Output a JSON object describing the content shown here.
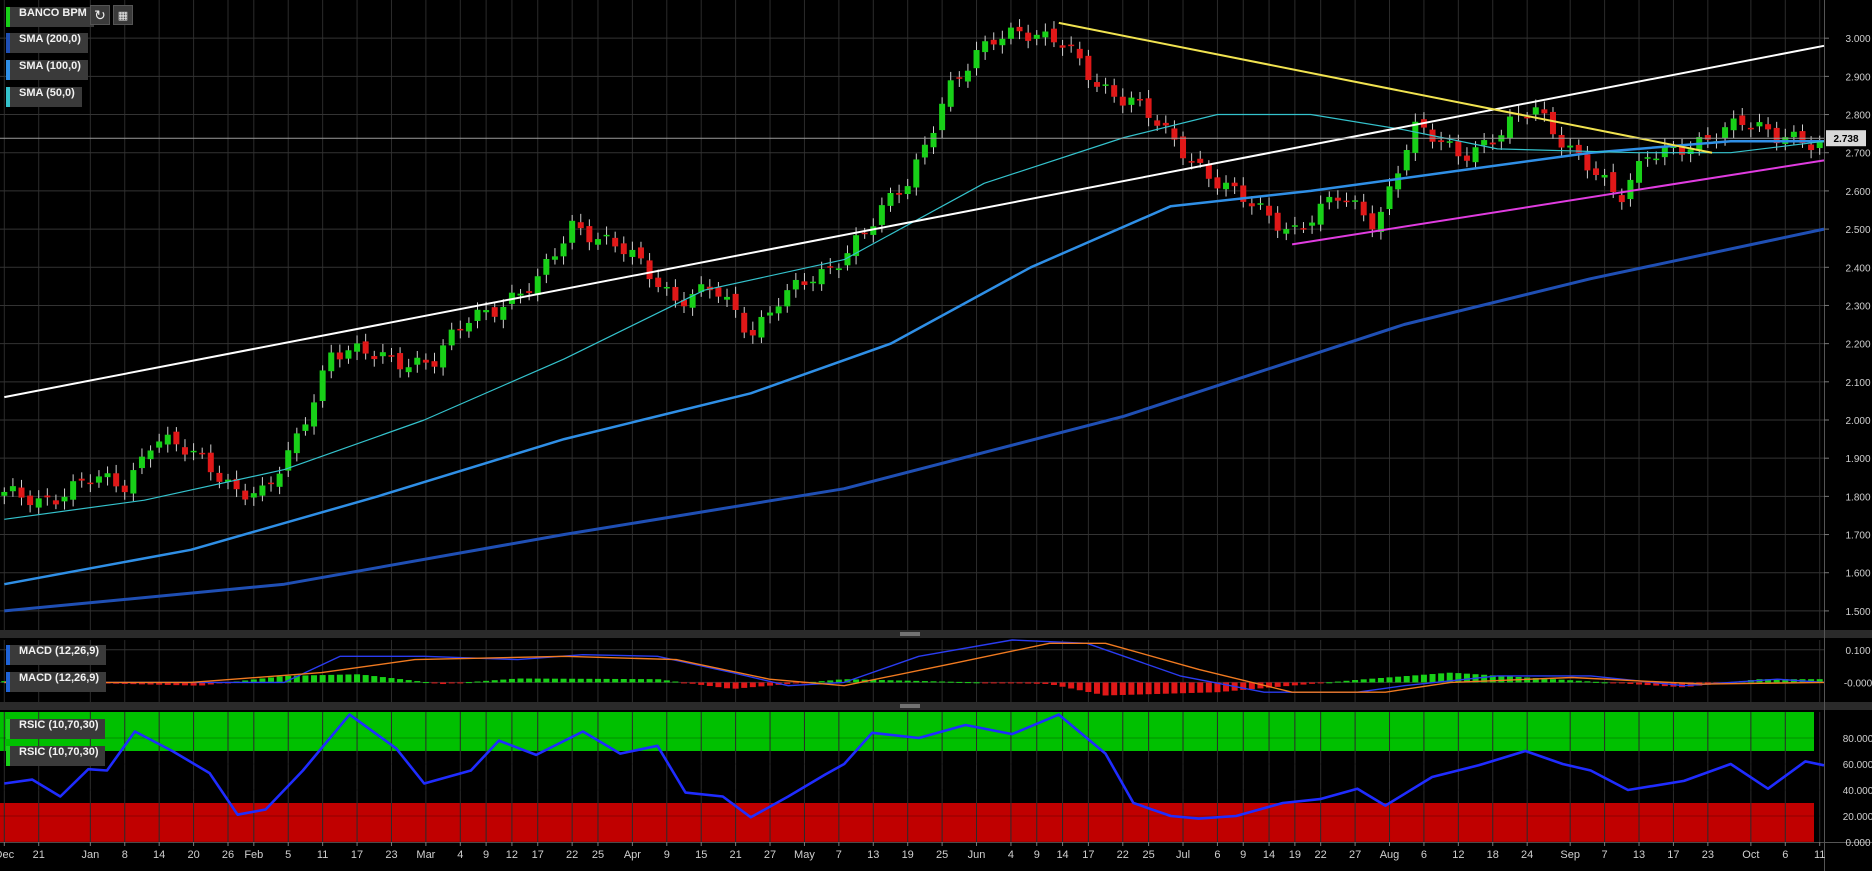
{
  "header": {
    "symbol": "BANCO BPM",
    "symbol_color": "#18d018",
    "refresh_icon": "refresh-icon",
    "settings_icon": "chart-settings-icon"
  },
  "price_panel": {
    "indicators": [
      {
        "label": "SMA (200,0)",
        "color": "#1f4fb4"
      },
      {
        "label": "SMA (100,0)",
        "color": "#2f8fe6"
      },
      {
        "label": "SMA (50,0)",
        "color": "#34c2cc"
      }
    ],
    "last_price_label": "2.738",
    "y_ticks": [
      "3.000",
      "2.900",
      "2.800",
      "2.700",
      "2.600",
      "2.500",
      "2.400",
      "2.300",
      "2.200",
      "2.100",
      "2.000",
      "1.900",
      "1.800",
      "1.700",
      "1.600",
      "1.500"
    ]
  },
  "macd_panel": {
    "labels": [
      "MACD (12,26,9)",
      "MACD (12,26,9)"
    ],
    "y_ticks": [
      "0.100",
      "-0.000"
    ]
  },
  "rsi_panel": {
    "labels": [
      "RSIC (10,70,30)",
      "RSIC (10,70,30)"
    ],
    "y_ticks": [
      "80.000",
      "60.000",
      "40.000",
      "20.000",
      "0.000"
    ]
  },
  "x_axis": {
    "ticks": [
      "Dec",
      "21",
      "Jan",
      "8",
      "14",
      "20",
      "26",
      "Feb",
      "5",
      "11",
      "17",
      "23",
      "Mar",
      "4",
      "9",
      "12",
      "17",
      "22",
      "25",
      "Apr",
      "9",
      "15",
      "21",
      "27",
      "May",
      "7",
      "13",
      "19",
      "25",
      "Jun",
      "4",
      "9",
      "14",
      "17",
      "22",
      "25",
      "Jul",
      "6",
      "9",
      "14",
      "19",
      "22",
      "27",
      "Aug",
      "6",
      "12",
      "18",
      "24",
      "Sep",
      "7",
      "13",
      "17",
      "23",
      "Oct",
      "6",
      "11"
    ]
  },
  "chart_data": [
    {
      "type": "candlestick",
      "y_range": [
        1.45,
        3.1
      ],
      "x_range": [
        0,
        195
      ],
      "x_tick_index": [
        0,
        4,
        10,
        14,
        18,
        22,
        26,
        29,
        33,
        37,
        41,
        45,
        49,
        53,
        56,
        59,
        62,
        66,
        69,
        73,
        77,
        81,
        85,
        89,
        93,
        97,
        101,
        105,
        109,
        113,
        117,
        120,
        123,
        126,
        130,
        133,
        137,
        141,
        144,
        147,
        150,
        153,
        157,
        161,
        165,
        169,
        173,
        177,
        182,
        186,
        190,
        194,
        198,
        203,
        207,
        211
      ],
      "price_path": [
        [
          0,
          1.8
        ],
        [
          4,
          1.79
        ],
        [
          9,
          1.84
        ],
        [
          13,
          1.83
        ],
        [
          16,
          1.96
        ],
        [
          22,
          1.88
        ],
        [
          25,
          1.82
        ],
        [
          28,
          1.8
        ],
        [
          31,
          1.93
        ],
        [
          35,
          2.18
        ],
        [
          42,
          2.16
        ],
        [
          46,
          2.15
        ],
        [
          50,
          2.27
        ],
        [
          57,
          2.35
        ],
        [
          61,
          2.52
        ],
        [
          67,
          2.43
        ],
        [
          72,
          2.32
        ],
        [
          76,
          2.34
        ],
        [
          80,
          2.23
        ],
        [
          83,
          2.32
        ],
        [
          88,
          2.38
        ],
        [
          91,
          2.47
        ],
        [
          97,
          2.62
        ],
        [
          101,
          2.87
        ],
        [
          106,
          2.99
        ],
        [
          109,
          3.03
        ],
        [
          113,
          2.99
        ],
        [
          117,
          2.88
        ],
        [
          121,
          2.84
        ],
        [
          125,
          2.73
        ],
        [
          129,
          2.65
        ],
        [
          134,
          2.55
        ],
        [
          138,
          2.5
        ],
        [
          143,
          2.58
        ],
        [
          147,
          2.52
        ],
        [
          151,
          2.76
        ],
        [
          156,
          2.7
        ],
        [
          160,
          2.74
        ],
        [
          164,
          2.82
        ],
        [
          168,
          2.71
        ],
        [
          173,
          2.57
        ],
        [
          176,
          2.71
        ],
        [
          181,
          2.7
        ],
        [
          186,
          2.8
        ],
        [
          190,
          2.73
        ]
      ],
      "trendlines": [
        {
          "name": "rising",
          "color": "#ffffff",
          "from": [
            0,
            2.06
          ],
          "to": [
            195,
            2.98
          ]
        },
        {
          "name": "falling",
          "color": "#f1e350",
          "from": [
            113,
            3.04
          ],
          "to": [
            183,
            2.7
          ]
        },
        {
          "name": "support",
          "color": "#e03ce0",
          "from": [
            138,
            2.46
          ],
          "to": [
            195,
            2.68
          ]
        }
      ],
      "horizontal_line": 2.738,
      "sma_200": [
        [
          0,
          1.5
        ],
        [
          30,
          1.57
        ],
        [
          60,
          1.7
        ],
        [
          90,
          1.82
        ],
        [
          120,
          2.01
        ],
        [
          150,
          2.25
        ],
        [
          170,
          2.37
        ],
        [
          195,
          2.5
        ]
      ],
      "sma_100": [
        [
          0,
          1.57
        ],
        [
          20,
          1.66
        ],
        [
          40,
          1.8
        ],
        [
          60,
          1.95
        ],
        [
          80,
          2.07
        ],
        [
          95,
          2.2
        ],
        [
          110,
          2.4
        ],
        [
          125,
          2.56
        ],
        [
          140,
          2.6
        ],
        [
          155,
          2.65
        ],
        [
          170,
          2.7
        ],
        [
          185,
          2.73
        ],
        [
          195,
          2.73
        ]
      ],
      "sma_50": [
        [
          0,
          1.74
        ],
        [
          15,
          1.79
        ],
        [
          30,
          1.87
        ],
        [
          45,
          2.0
        ],
        [
          60,
          2.16
        ],
        [
          75,
          2.34
        ],
        [
          90,
          2.42
        ],
        [
          105,
          2.62
        ],
        [
          120,
          2.74
        ],
        [
          130,
          2.8
        ],
        [
          140,
          2.8
        ],
        [
          150,
          2.76
        ],
        [
          160,
          2.71
        ],
        [
          175,
          2.7
        ],
        [
          185,
          2.7
        ],
        [
          195,
          2.73
        ]
      ],
      "colors": {
        "up": "#18d018",
        "down": "#e01818",
        "sma_200": "#1f4fb4",
        "sma_100": "#2f8fe6",
        "sma_50": "#34c2cc"
      }
    },
    {
      "type": "macd",
      "y_range": [
        -0.06,
        0.13
      ],
      "macd_line": [
        [
          0,
          0.0
        ],
        [
          12,
          0.0
        ],
        [
          30,
          0.0
        ],
        [
          36,
          0.08
        ],
        [
          45,
          0.08
        ],
        [
          55,
          0.07
        ],
        [
          62,
          0.085
        ],
        [
          70,
          0.08
        ],
        [
          78,
          0.03
        ],
        [
          84,
          -0.01
        ],
        [
          90,
          0.0
        ],
        [
          98,
          0.08
        ],
        [
          108,
          0.13
        ],
        [
          116,
          0.12
        ],
        [
          126,
          0.02
        ],
        [
          135,
          -0.03
        ],
        [
          145,
          -0.03
        ],
        [
          150,
          -0.01
        ],
        [
          160,
          0.02
        ],
        [
          170,
          0.02
        ],
        [
          180,
          -0.01
        ],
        [
          190,
          0.01
        ],
        [
          195,
          0.0
        ]
      ],
      "signal_line": [
        [
          0,
          0.0
        ],
        [
          20,
          0.0
        ],
        [
          34,
          0.03
        ],
        [
          44,
          0.07
        ],
        [
          60,
          0.08
        ],
        [
          72,
          0.07
        ],
        [
          82,
          0.01
        ],
        [
          90,
          -0.01
        ],
        [
          102,
          0.06
        ],
        [
          112,
          0.12
        ],
        [
          118,
          0.12
        ],
        [
          128,
          0.04
        ],
        [
          138,
          -0.03
        ],
        [
          148,
          -0.03
        ],
        [
          155,
          0.0
        ],
        [
          168,
          0.015
        ],
        [
          182,
          -0.005
        ],
        [
          195,
          0.0
        ]
      ],
      "histogram_phases": [
        [
          0,
          0.004
        ],
        [
          21,
          -0.01
        ],
        [
          30,
          0.02
        ],
        [
          38,
          0.025
        ],
        [
          47,
          -0.005
        ],
        [
          55,
          0.012
        ],
        [
          70,
          0.01
        ],
        [
          78,
          -0.02
        ],
        [
          90,
          0.01
        ],
        [
          112,
          -0.005
        ],
        [
          118,
          -0.04
        ],
        [
          130,
          -0.03
        ],
        [
          145,
          0.008
        ],
        [
          155,
          0.03
        ],
        [
          166,
          0.01
        ],
        [
          180,
          -0.015
        ],
        [
          188,
          0.01
        ],
        [
          195,
          0.01
        ]
      ],
      "colors": {
        "macd": "#2a3cf0",
        "signal": "#f07a20",
        "hist_up": "#18d018",
        "hist_down": "#e01818"
      }
    },
    {
      "type": "rsi",
      "y_range": [
        0,
        100
      ],
      "overbought": 70,
      "oversold": 30,
      "rsi_path": [
        [
          0,
          45
        ],
        [
          3,
          48
        ],
        [
          6,
          35
        ],
        [
          9,
          56
        ],
        [
          11,
          55
        ],
        [
          14,
          85
        ],
        [
          18,
          70
        ],
        [
          22,
          53
        ],
        [
          25,
          21
        ],
        [
          28,
          25
        ],
        [
          32,
          55
        ],
        [
          37,
          98
        ],
        [
          42,
          72
        ],
        [
          45,
          45
        ],
        [
          50,
          55
        ],
        [
          53,
          78
        ],
        [
          57,
          67
        ],
        [
          62,
          85
        ],
        [
          66,
          68
        ],
        [
          70,
          74
        ],
        [
          73,
          38
        ],
        [
          77,
          35
        ],
        [
          80,
          19
        ],
        [
          84,
          35
        ],
        [
          88,
          52
        ],
        [
          90,
          60
        ],
        [
          93,
          84
        ],
        [
          98,
          80
        ],
        [
          103,
          90
        ],
        [
          108,
          83
        ],
        [
          113,
          98
        ],
        [
          118,
          68
        ],
        [
          121,
          30
        ],
        [
          125,
          20
        ],
        [
          128,
          18
        ],
        [
          132,
          20
        ],
        [
          137,
          30
        ],
        [
          141,
          33
        ],
        [
          145,
          41
        ],
        [
          148,
          28
        ],
        [
          153,
          50
        ],
        [
          158,
          59
        ],
        [
          163,
          70
        ],
        [
          167,
          60
        ],
        [
          170,
          55
        ],
        [
          174,
          40
        ],
        [
          180,
          47
        ],
        [
          185,
          60
        ],
        [
          189,
          41
        ],
        [
          193,
          62
        ],
        [
          195,
          59
        ]
      ],
      "colors": {
        "rsi": "#1f2cff",
        "overbought_zone": "#00c000",
        "oversold_zone": "#c00000"
      }
    }
  ]
}
